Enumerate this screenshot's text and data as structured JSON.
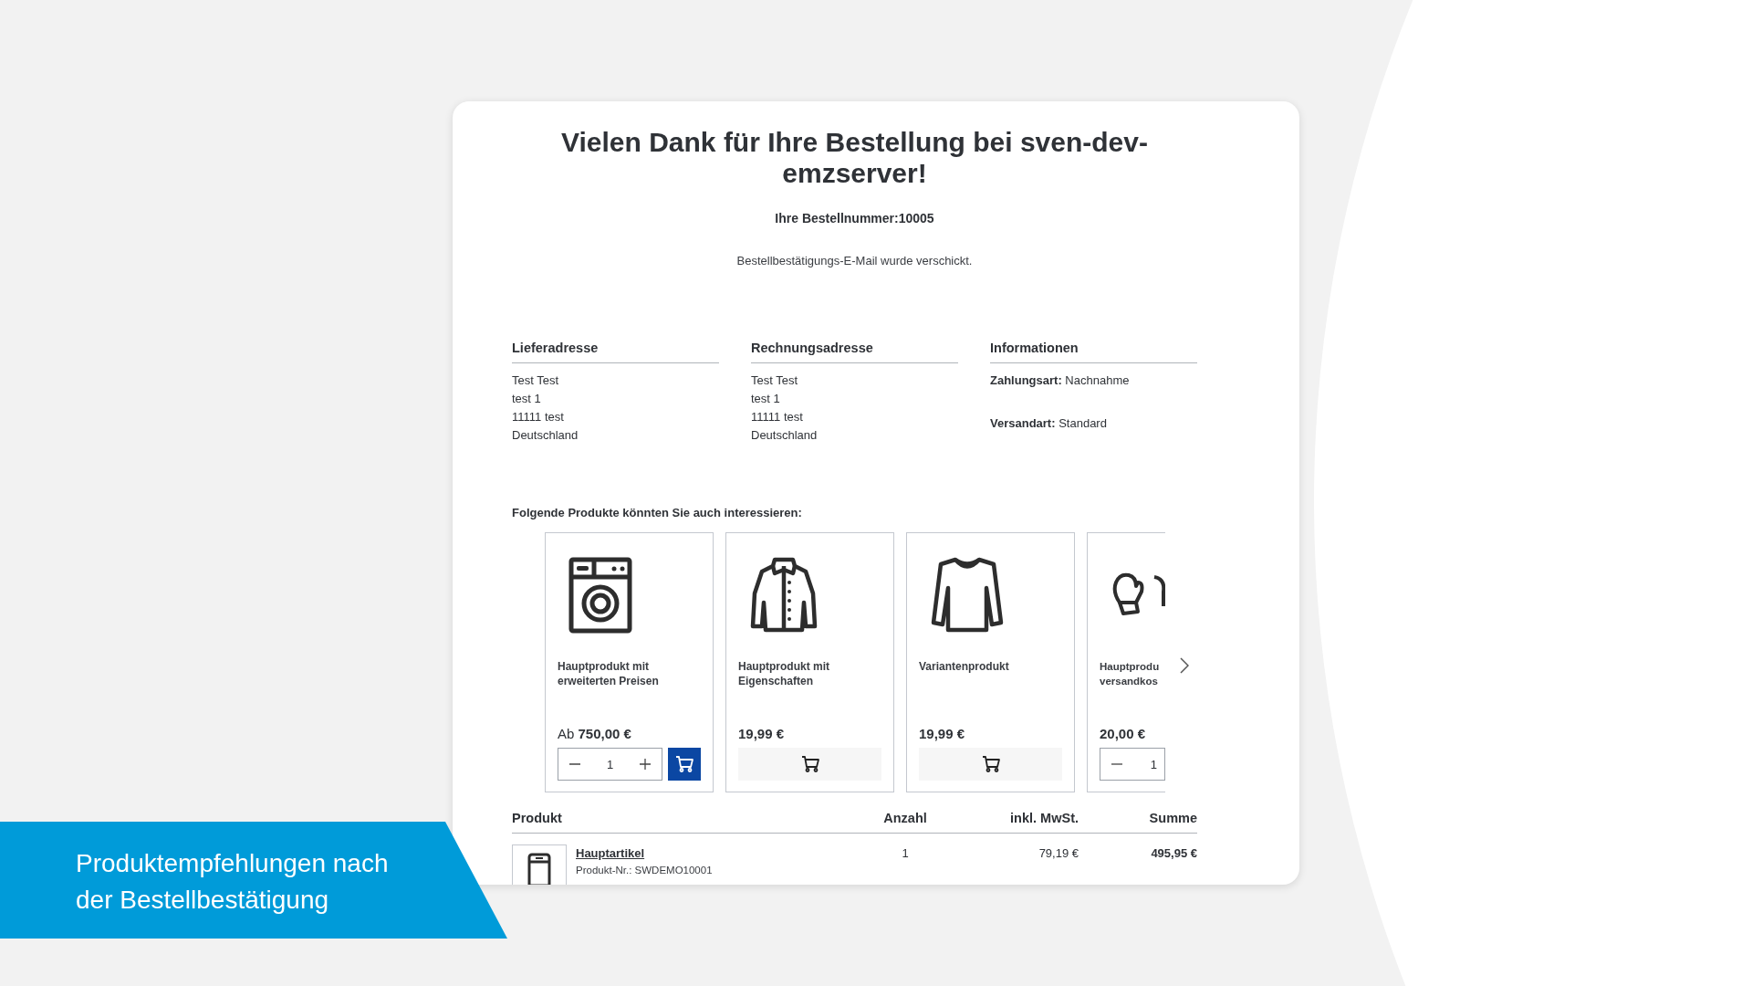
{
  "banner": {
    "lines": [
      "Produktempfehlungen nach",
      "der Bestellbestätigung"
    ]
  },
  "confirmation": {
    "title": "Vielen Dank für Ihre Bestellung bei sven-dev-emzserver!",
    "order_number": "Ihre Bestellnummer:10005",
    "email_notice": "Bestellbestätigungs-E-Mail wurde verschickt."
  },
  "addresses": [
    {
      "heading": "Lieferadresse",
      "lines": [
        "Test Test",
        "test 1",
        "11111 test",
        "Deutschland"
      ]
    },
    {
      "heading": "Rechnungsadresse",
      "lines": [
        "Test Test",
        "test 1",
        "11111 test",
        "Deutschland"
      ]
    }
  ],
  "information": {
    "heading": "Informationen",
    "entries": [
      {
        "label": "Zahlungsart:",
        "value": "Nachnahme"
      },
      {
        "label": "Versandart:",
        "value": "Standard"
      }
    ]
  },
  "recommendations": {
    "heading": "Folgende Produkte könnten Sie auch interessieren:",
    "products": [
      {
        "name": "Hauptprodukt mit erweiterten Preisen",
        "price_prefix": "Ab",
        "price": "750,00 €",
        "kind": "stepper",
        "quantity": "1",
        "partial": false
      },
      {
        "name": "Hauptprodukt mit Eigenschaften",
        "price": "19,99 €",
        "kind": "plain",
        "partial": false
      },
      {
        "name": "Variantenprodukt",
        "price": "19,99 €",
        "kind": "plain",
        "partial": false
      },
      {
        "name": "Hauptprodu\nversandkos",
        "price": "20,00 €",
        "kind": "stepper",
        "quantity": "1",
        "partial": true
      }
    ]
  },
  "order_table": {
    "columns": [
      "Produkt",
      "Anzahl",
      "inkl. MwSt.",
      "Summe"
    ],
    "rows": [
      {
        "name": "Hauptartikel",
        "product_number": "Produkt-Nr.: SWDEMO10001",
        "quantity": "1",
        "unit_price": "79,19 €",
        "total": "495,95 €"
      }
    ]
  }
}
